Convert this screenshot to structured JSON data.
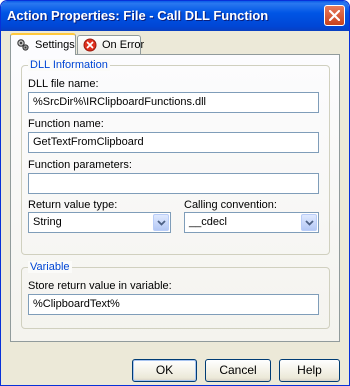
{
  "window": {
    "title": "Action Properties: File - Call DLL Function",
    "close_icon": "close-icon"
  },
  "tabs": [
    {
      "label": "Settings",
      "icon": "settings-gears-icon",
      "active": true
    },
    {
      "label": "On Error",
      "icon": "error-icon",
      "active": false
    }
  ],
  "dll_group": {
    "legend": "DLL Information",
    "dll_file_label": "DLL file name:",
    "dll_file_value": "%SrcDir%\\IRClipboardFunctions.dll",
    "function_label": "Function name:",
    "function_value": "GetTextFromClipboard",
    "params_label": "Function parameters:",
    "params_value": "",
    "return_label": "Return value type:",
    "return_value": "String",
    "calling_label": "Calling convention:",
    "calling_value": "__cdecl"
  },
  "variable_group": {
    "legend": "Variable",
    "store_label": "Store return value in variable:",
    "store_value": "%ClipboardText%"
  },
  "buttons": {
    "ok": "OK",
    "cancel": "Cancel",
    "help": "Help"
  },
  "colors": {
    "title_bar": "#0055e5",
    "group_legend": "#0046d5",
    "dialog_bg": "#ece9d8",
    "close_button": "#d2522c"
  }
}
